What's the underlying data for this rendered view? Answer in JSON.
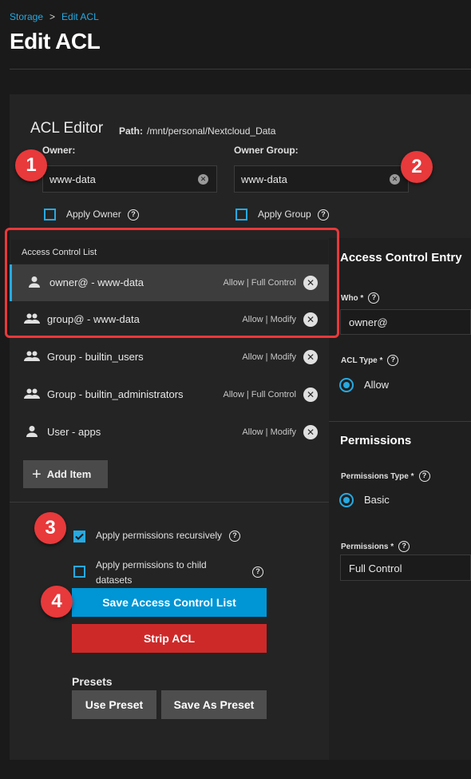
{
  "breadcrumb": {
    "parent": "Storage",
    "separator": ">",
    "current": "Edit ACL"
  },
  "page_title": "Edit ACL",
  "editor": {
    "title": "ACL Editor",
    "path_label": "Path:",
    "path_value": "/mnt/personal/Nextcloud_Data",
    "owner_label": "Owner:",
    "owner_value": "www-data",
    "owner_group_label": "Owner Group:",
    "owner_group_value": "www-data",
    "apply_owner_label": "Apply Owner",
    "apply_group_label": "Apply Group"
  },
  "badges": [
    "1",
    "2",
    "3",
    "4"
  ],
  "acl_list": {
    "header": "Access Control List",
    "items": [
      {
        "icon": "user-icon",
        "name": "owner@ - www-data",
        "perm": "Allow | Full Control",
        "selected": true
      },
      {
        "icon": "group-icon",
        "name": "group@ - www-data",
        "perm": "Allow | Modify",
        "selected": false
      },
      {
        "icon": "group-icon",
        "name": "Group - builtin_users",
        "perm": "Allow | Modify",
        "selected": false
      },
      {
        "icon": "group-icon",
        "name": "Group - builtin_administrators",
        "perm": "Allow | Full Control",
        "selected": false
      },
      {
        "icon": "user-icon",
        "name": "User - apps",
        "perm": "Allow | Modify",
        "selected": false
      }
    ],
    "add_item_label": "Add Item"
  },
  "options": {
    "recursive_label": "Apply permissions recursively",
    "recursive_checked": true,
    "child_datasets_label_line1": "Apply permissions to child",
    "child_datasets_label_line2": "datasets",
    "child_datasets_checked": false
  },
  "actions": {
    "save_label": "Save Access Control List",
    "strip_label": "Strip ACL",
    "presets_label": "Presets",
    "use_preset_label": "Use Preset",
    "save_as_preset_label": "Save As Preset"
  },
  "ace": {
    "title": "Access Control Entry",
    "who_label": "Who *",
    "who_value": "owner@",
    "acl_type_label": "ACL Type *",
    "acl_type_value": "Allow",
    "permissions_title": "Permissions",
    "permissions_type_label": "Permissions Type *",
    "permissions_type_value": "Basic",
    "permissions_label": "Permissions *",
    "permissions_value": "Full Control"
  },
  "colors": {
    "accent": "#27a9e1",
    "primary_button": "#0095d5",
    "danger_button": "#ce2929",
    "callout_badge": "#e8393b",
    "background": "#1a1a1a",
    "card": "#242424"
  }
}
